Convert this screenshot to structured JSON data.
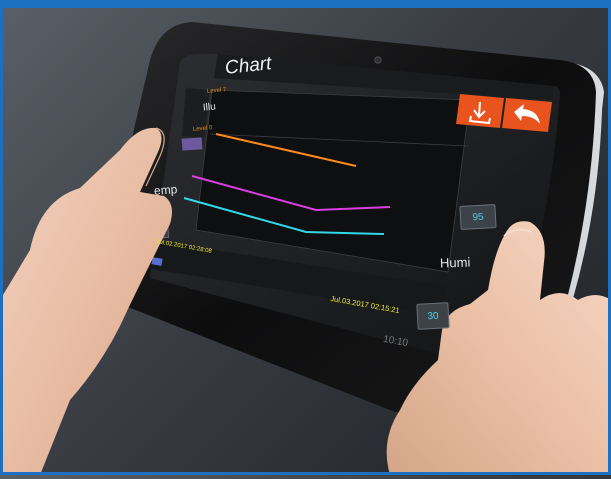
{
  "screen": {
    "title": "Chart",
    "illuminance": {
      "label": "Illu",
      "level_max_label": "Level 7",
      "level_min_label": "Level 0"
    },
    "temperature": {
      "label": "emp",
      "max_button": "",
      "min_button": ""
    },
    "humidity": {
      "label": "Humi",
      "max_button": "95",
      "min_button": "30"
    },
    "start_time": "Jul.02.2017  02:28:08",
    "end_time": "Jul.03.2017  02:15:21",
    "clock": "10:10"
  },
  "colors": {
    "illuminance_line": "#ff8a1e",
    "temperature_line": "#d940e0",
    "humidity_line": "#32d8e6",
    "action_buttons": "#e8531e",
    "frame": "#1d6fc0"
  },
  "icons": {
    "download": "download-icon",
    "back": "back-arrow-icon",
    "camera": "front-camera-icon"
  }
}
